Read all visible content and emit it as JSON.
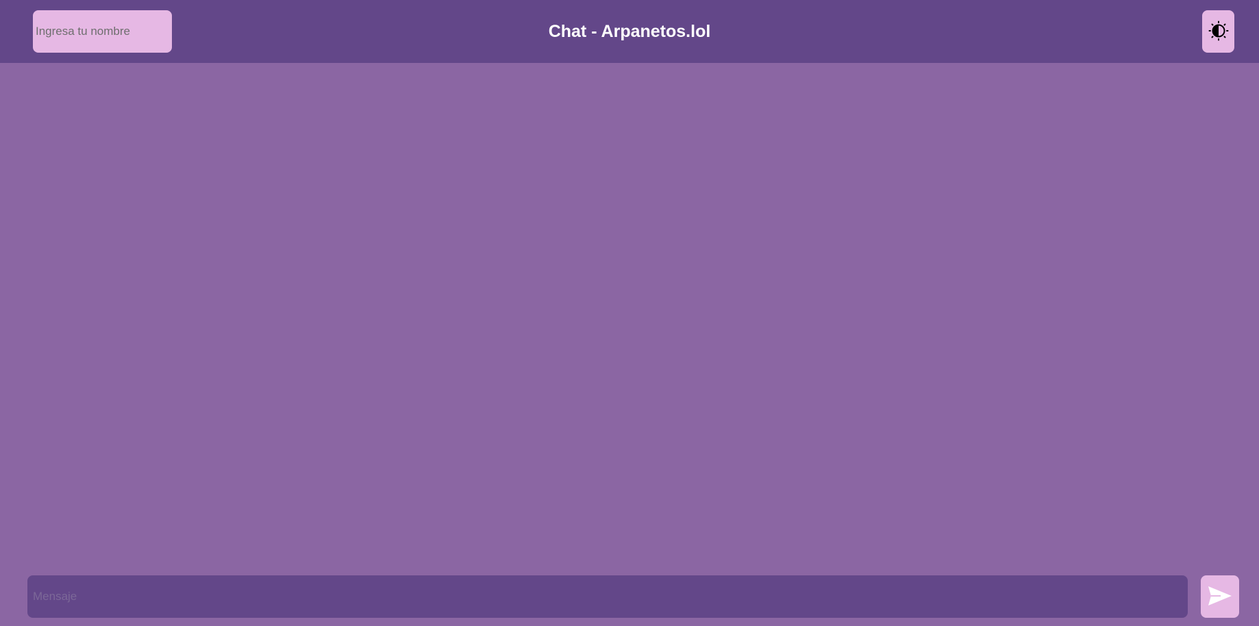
{
  "header": {
    "title": "Chat - Arpanetos.lol",
    "name_input": {
      "value": "",
      "placeholder": "Ingresa tu nombre"
    },
    "theme_toggle_icon": "half-sun-icon"
  },
  "chat": {
    "messages": []
  },
  "composer": {
    "message_input": {
      "value": "",
      "placeholder": "Mensaje"
    },
    "send_icon": "send-icon"
  },
  "colors": {
    "header_bg": "#634789",
    "page_bg": "#8b66a3",
    "accent": "#e6b8e4",
    "title_text": "#ffffff"
  }
}
